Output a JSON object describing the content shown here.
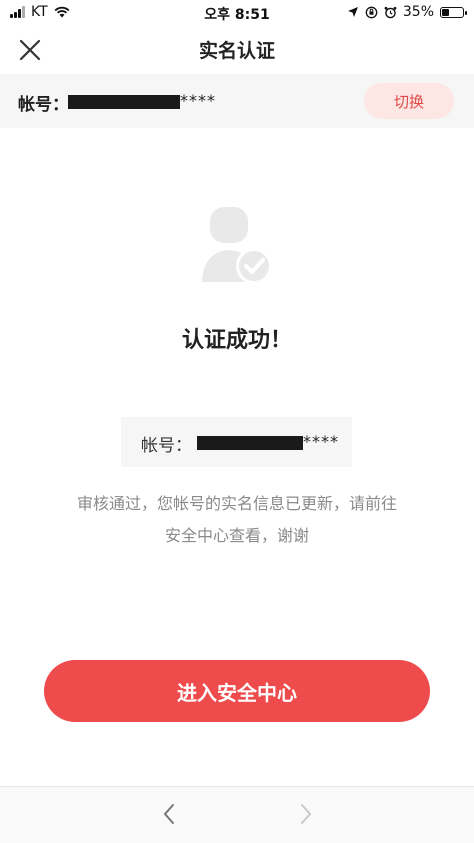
{
  "status_bar": {
    "carrier": "KT",
    "time": "오후 8:51",
    "battery": "35%",
    "battery_level": 0.35
  },
  "nav": {
    "title": "实名认证",
    "close_icon": "close-icon"
  },
  "account_bar": {
    "label": "帐号：",
    "value_suffix": "****",
    "switch_label": "切换"
  },
  "result": {
    "icon": "user-check-icon",
    "title": "认证成功！",
    "account_label": "帐号：",
    "account_suffix": "****",
    "desc_line1": "审核通过，您帐号的实名信息已更新，请前往",
    "desc_line2": "安全中心查看，谢谢"
  },
  "primary_button": {
    "label": "进入安全中心"
  },
  "bottom_nav": {
    "back_icon": "chevron-left-icon",
    "forward_icon": "chevron-right-icon"
  },
  "colors": {
    "accent": "#ee4c4c",
    "switch_bg": "#fde6e4",
    "switch_text": "#e04a46",
    "muted_text": "#8a8a8a",
    "panel_bg": "#f6f6f6"
  }
}
